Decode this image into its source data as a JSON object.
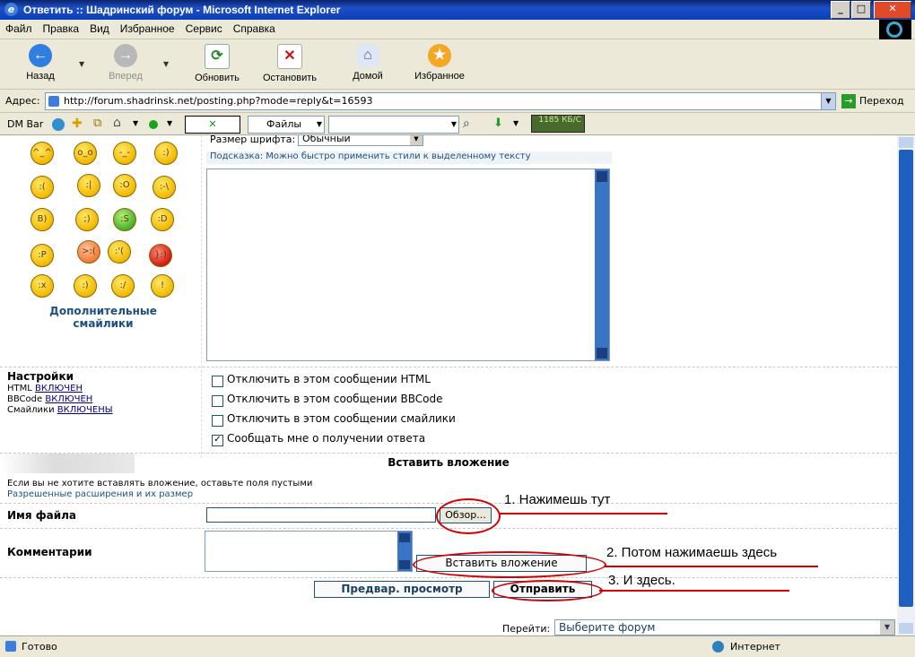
{
  "window": {
    "title": "Ответить :: Шадринский форум - Microsoft Internet Explorer"
  },
  "menu": [
    "Файл",
    "Правка",
    "Вид",
    "Избранное",
    "Сервис",
    "Справка"
  ],
  "toolbar": {
    "back": "Назад",
    "forward": "Вперед",
    "refresh": "Обновить",
    "stop": "Остановить",
    "home": "Домой",
    "favorites": "Избранное"
  },
  "address": {
    "label": "Адрес:",
    "url": "http://forum.shadrinsk.net/posting.php?mode=reply&t=16593",
    "go": "Переход"
  },
  "dmbar": {
    "label": "DM Bar",
    "files": "Файлы",
    "speed": "1185 КБ/С"
  },
  "editor": {
    "font_size_label": "Размер шрифта:",
    "font_size_value": "Обычный",
    "hint": "Подсказка: Можно быстро применить стили к выделенному тексту"
  },
  "smilies": {
    "more_link": "Дополнительные смайлики"
  },
  "settings": {
    "title": "Настройки",
    "html_label": "HTML",
    "html_state": "ВКЛЮЧЕН",
    "bbcode_label": "BBCode",
    "bbcode_state": "ВКЛЮЧЕН",
    "smilies_label": "Смайлики",
    "smilies_state": "ВКЛЮЧЕНЫ"
  },
  "options": [
    {
      "label": "Отключить в этом сообщении HTML",
      "checked": false
    },
    {
      "label": "Отключить в этом сообщении BBCode",
      "checked": false
    },
    {
      "label": "Отключить в этом сообщении смайлики",
      "checked": false
    },
    {
      "label": "Сообщать мне о получении ответа",
      "checked": true
    }
  ],
  "attach": {
    "title": "Вставить вложение",
    "note": "Если вы не хотите вставлять вложение, оставьте поля пустыми",
    "extensions": "Разрешенные расширения и их размер",
    "filename_label": "Имя файла",
    "browse": "Обзор...",
    "comment_label": "Комментарии",
    "insert_button": "Вставить вложение"
  },
  "actions": {
    "preview": "Предвар. просмотр",
    "submit": "Отправить"
  },
  "jump": {
    "label": "Перейти:",
    "value": "Выберите форум"
  },
  "annotations": {
    "step1": "1. Нажимешь тут",
    "step2": "2. Потом нажимаешь здесь",
    "step3": "3. И здесь."
  },
  "status": {
    "left": "Готово",
    "zone": "Интернет"
  },
  "colors": {
    "title_bar": "#0b3fb5",
    "link": "#1d4f82",
    "annotation": "#d40000",
    "scrollbar": "#1f5fbf"
  }
}
